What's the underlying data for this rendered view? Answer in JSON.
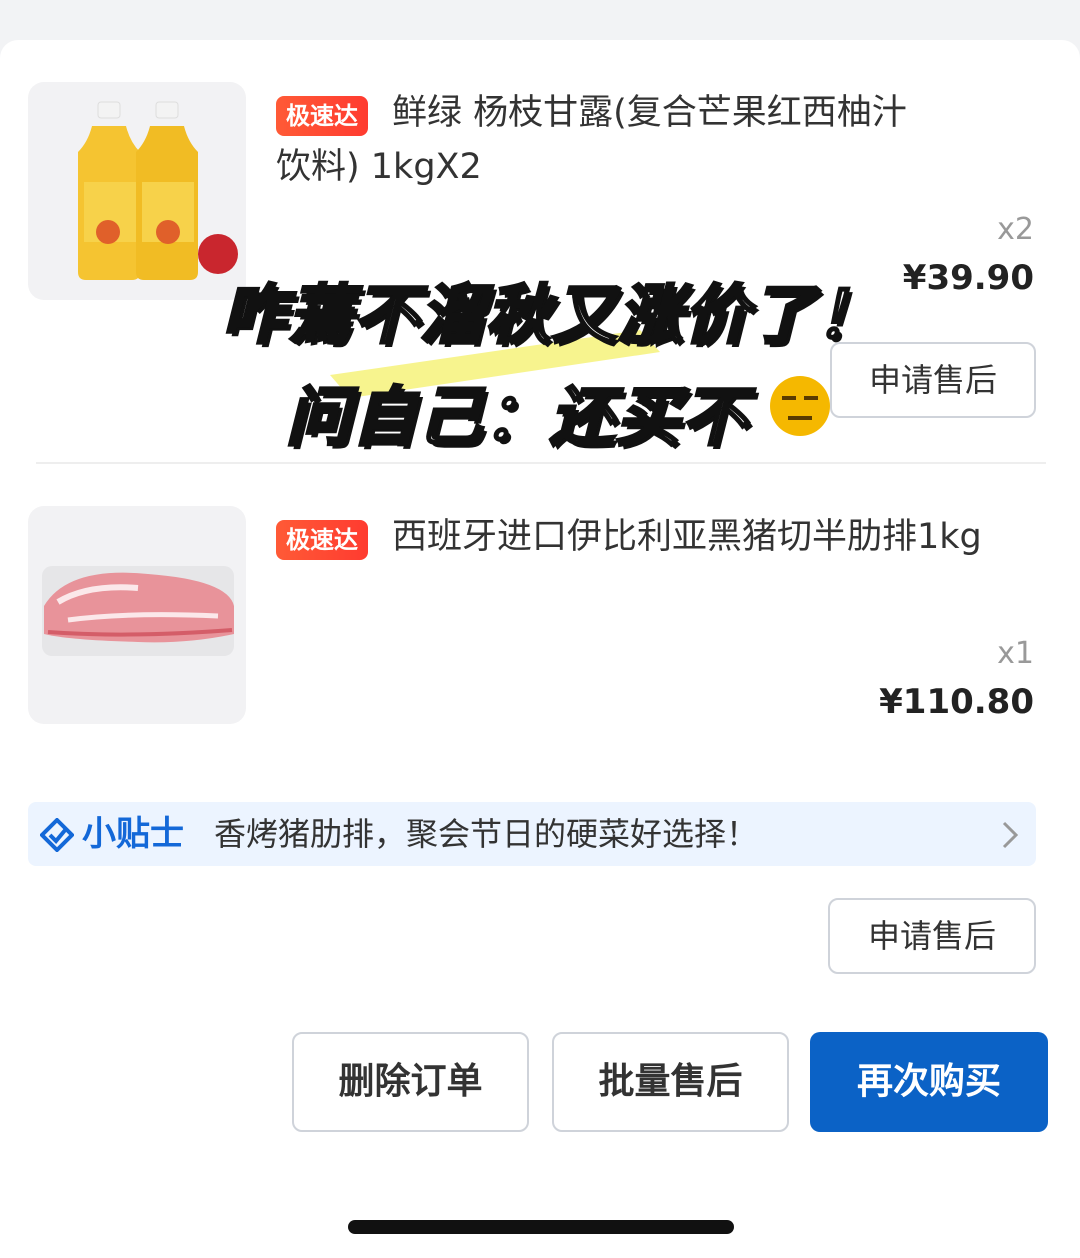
{
  "items": [
    {
      "badge": "极速达",
      "title_line1": "鲜绿 杨枝甘露(复合芒果红西柚汁",
      "title_line2": "饮料) 1kgX2",
      "qty": "x2",
      "price": "¥39.90",
      "aftersale_label": "申请售后"
    },
    {
      "badge": "极速达",
      "title_line1": "西班牙进口伊比利亚黑猪切半肋排1kg",
      "qty": "x1",
      "price": "¥110.80"
    }
  ],
  "tip": {
    "brand": "小贴士",
    "text": "香烤猪肋排，聚会节日的硬菜好选择！"
  },
  "order_aftersale_label": "申请售后",
  "actions": {
    "delete": "删除订单",
    "batch": "批量售后",
    "rebuy": "再次购买"
  },
  "overlay": {
    "line1": "咋蔫不溜秋又涨价了！",
    "line2": "问自己：还买不"
  },
  "colors": {
    "accent": "#0b62c6",
    "badge": "#ff3b30",
    "tip_bg": "#ecf4ff"
  }
}
